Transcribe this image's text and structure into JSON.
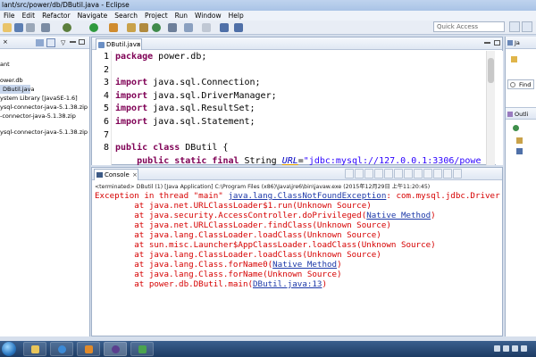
{
  "window": {
    "title": "lant/src/power/db/DButil.java - Eclipse"
  },
  "menu": [
    "File",
    "Edit",
    "Refactor",
    "Navigate",
    "Search",
    "Project",
    "Run",
    "Window",
    "Help"
  ],
  "quick_access": {
    "placeholder": "Quick Access"
  },
  "package_explorer": {
    "items": [
      "ant",
      "ower.db",
      "DButil.java",
      "ystem Library [JavaSE-1.6]",
      "ysql-connector-java-5.1.38.zip",
      "-connector-java-5.1.38.zip",
      "ysql-connector-java-5.1.38.zip"
    ]
  },
  "editor": {
    "tab_label": "DButil.java",
    "line_numbers": [
      "1",
      "2",
      "3",
      "4",
      "5",
      "6",
      "7",
      "8"
    ]
  },
  "right_panel": {
    "tab_label": "Ja",
    "find_label": "Find",
    "outline_label": "Outli"
  },
  "console": {
    "tab_label": "Console",
    "terminated": "<terminated> DButil (1) [Java Application] C:\\Program Files (x86)\\Java\\jre6\\bin\\javaw.exe (2015年12月29日 上午11:20:45)",
    "exception_prefix": "Exception in thread \"main\" ",
    "exception_class": "java.lang.ClassNotFoundException",
    "exception_suffix": ": com.mysql.jdbc.Driver",
    "stack": [
      "        at java.net.URLClassLoader$1.run(Unknown Source)",
      "        at java.security.AccessController.doPrivileged(",
      "        at java.net.URLClassLoader.findClass(Unknown Source)",
      "        at java.lang.ClassLoader.loadClass(Unknown Source)",
      "        at sun.misc.Launcher$AppClassLoader.loadClass(Unknown Source)",
      "        at java.lang.ClassLoader.loadClass(Unknown Source)",
      "        at java.lang.Class.forName0(",
      "        at java.lang.Class.forName(Unknown Source)",
      "        at power.db.DButil.main("
    ],
    "native_method": "Native Method",
    "source_link": "DButil.java:13"
  }
}
